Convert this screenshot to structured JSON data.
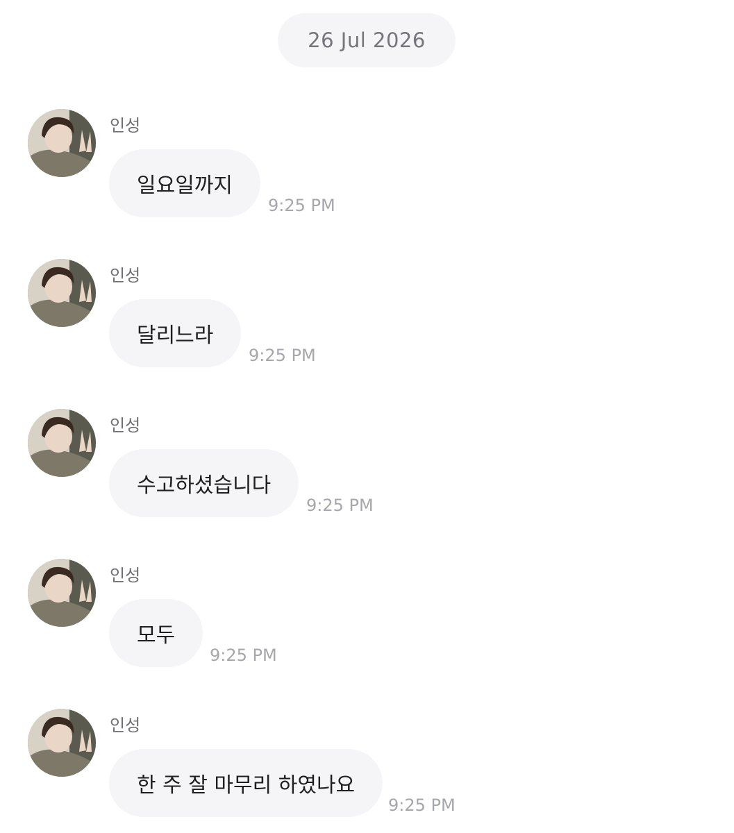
{
  "date_divider": "26 Jul 2026",
  "messages": [
    {
      "sender": "인성",
      "text": "일요일까지",
      "time": "9:25 PM"
    },
    {
      "sender": "인성",
      "text": "달리느라",
      "time": "9:25 PM"
    },
    {
      "sender": "인성",
      "text": "수고하셨습니다",
      "time": "9:25 PM"
    },
    {
      "sender": "인성",
      "text": "모두",
      "time": "9:25 PM"
    },
    {
      "sender": "인성",
      "text": "한 주 잘 마무리 하였나요",
      "time": "9:25 PM"
    }
  ],
  "colors": {
    "bubble_bg": "#f5f5f8",
    "text": "#1f1f22",
    "sender": "#6f6f74",
    "timestamp": "#a6a6ad"
  },
  "icons": {
    "avatar": "profile-photo"
  }
}
